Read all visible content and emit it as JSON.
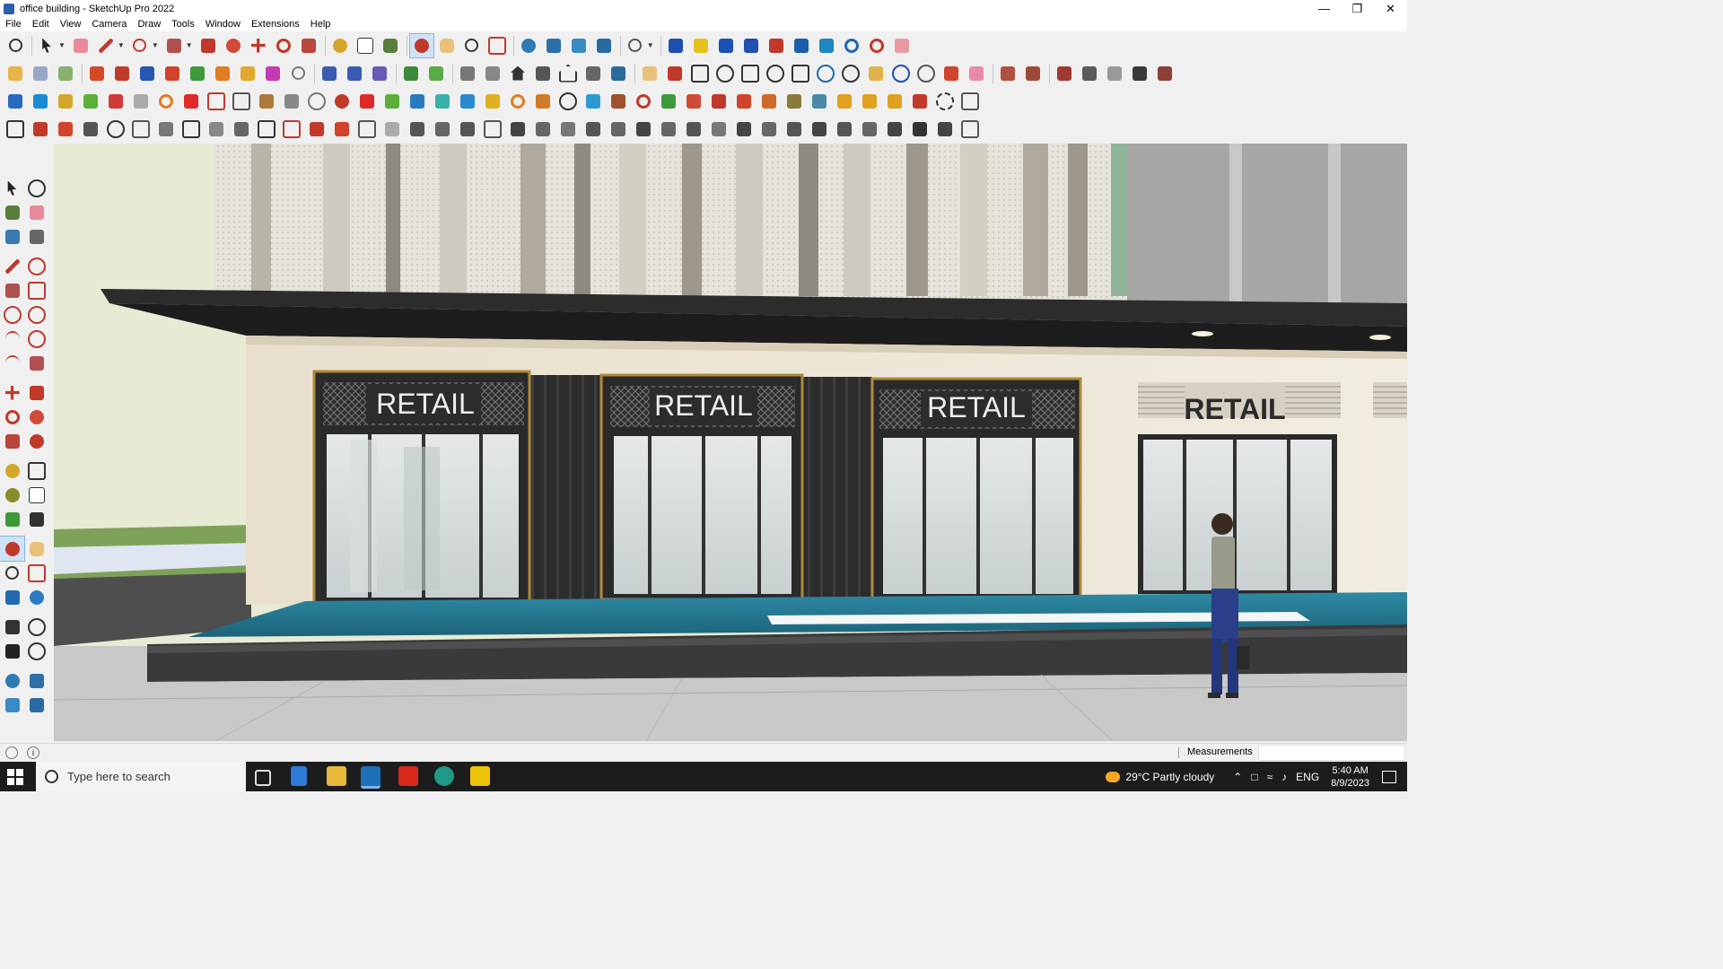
{
  "window": {
    "title": "office building - SketchUp Pro 2022"
  },
  "menu": [
    "File",
    "Edit",
    "View",
    "Camera",
    "Draw",
    "Tools",
    "Window",
    "Extensions",
    "Help"
  ],
  "viewport": {
    "signs": [
      "RETAIL",
      "RETAIL",
      "RETAIL",
      "RETAIL"
    ]
  },
  "status": {
    "measurements_label": "Measurements",
    "measurements_value": ""
  },
  "taskbar": {
    "search_placeholder": "Type here to search",
    "weather": "29°C  Partly cloudy",
    "language": "ENG",
    "time": "5:40 AM",
    "date": "8/9/2023"
  },
  "colors": {
    "accent": "#cfe3f6",
    "glass_band": "#2a7a93",
    "taskbar": "#1c1c1c"
  }
}
